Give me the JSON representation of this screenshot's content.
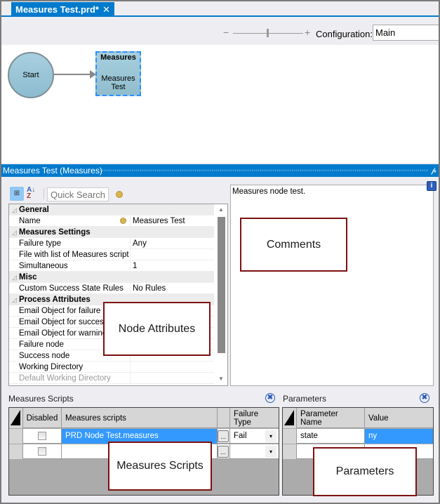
{
  "tab": {
    "title": "Measures Test.prd*",
    "close": "✕"
  },
  "toolbar": {
    "zoom_minus": "−",
    "zoom_plus": "+",
    "zoom_level": 0.5,
    "configuration_label": "Configuration:",
    "configuration_value": "Main"
  },
  "canvas": {
    "start_node": "Start",
    "measures_node": {
      "type": "Measures",
      "name_line1": "Measures",
      "name_line2": "Test"
    }
  },
  "panel": {
    "title": "Measures Test (Measures)",
    "pin": "ᵽ"
  },
  "property_grid": {
    "search_placeholder": "Quick Search",
    "categories": [
      {
        "name": "General",
        "rows": [
          {
            "key": "Name",
            "value": "Measures Test",
            "has_icon": true
          }
        ]
      },
      {
        "name": "Measures Settings",
        "rows": [
          {
            "key": "Failure type",
            "value": "Any"
          },
          {
            "key": "File with list of Measures scripts",
            "value": ""
          },
          {
            "key": "Simultaneous",
            "value": "1"
          }
        ]
      },
      {
        "name": "Misc",
        "rows": [
          {
            "key": "Custom Success State Rules",
            "value": "No Rules"
          }
        ]
      },
      {
        "name": "Process Attributes",
        "rows": [
          {
            "key": "Email Object for failure",
            "value": ""
          },
          {
            "key": "Email Object for success",
            "value": ""
          },
          {
            "key": "Email Object for warning",
            "value": ""
          },
          {
            "key": "Failure node",
            "value": ""
          },
          {
            "key": "Success node",
            "value": ""
          },
          {
            "key": "Working Directory",
            "value": ""
          },
          {
            "key": "Default Working Directory",
            "value": "",
            "disabled": true
          }
        ]
      }
    ]
  },
  "comments": {
    "text": "Measures node test.",
    "info": "i"
  },
  "callouts": {
    "node_attributes": "Node Attributes",
    "comments": "Comments",
    "measures_scripts": "Measures Scripts",
    "parameters": "Parameters"
  },
  "measures_scripts": {
    "title": "Measures Scripts",
    "columns": [
      "Disabled",
      "Measures scripts",
      "",
      "Failure Type"
    ],
    "rows": [
      {
        "disabled": false,
        "script": "PRD Node Test.measures",
        "failure_type": "Fail",
        "selected": true
      },
      {
        "disabled": false,
        "script": "",
        "failure_type": "",
        "selected": false
      }
    ],
    "ellipsis": "...",
    "dropdown": "▾"
  },
  "parameters": {
    "title": "Parameters",
    "columns": [
      "Parameter Name",
      "Value"
    ],
    "rows": [
      {
        "name": "state",
        "value": "ny"
      },
      {
        "name": "",
        "value": ""
      }
    ]
  },
  "icons": {
    "close": "✖",
    "az": "A Z",
    "cat": "⊞"
  }
}
